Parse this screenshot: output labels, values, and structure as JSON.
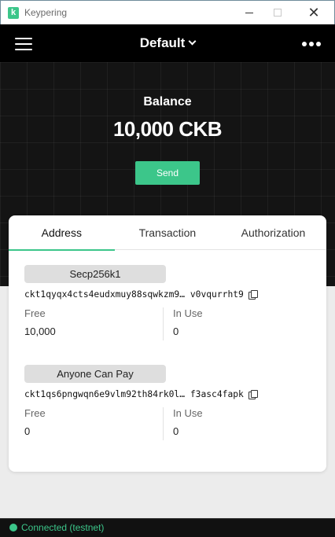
{
  "window": {
    "title": "Keypering",
    "logo_letter": "k"
  },
  "nav": {
    "wallet_name": "Default"
  },
  "hero": {
    "balance_label": "Balance",
    "balance_value": "10,000 CKB",
    "send_label": "Send"
  },
  "tabs": [
    {
      "label": "Address",
      "active": true
    },
    {
      "label": "Transaction",
      "active": false
    },
    {
      "label": "Authorization",
      "active": false
    }
  ],
  "accounts": [
    {
      "lock_type": "Secp256k1",
      "address": "ckt1qyqx4cts4eudxmuy88sqwkzm9… v0vqurrht9",
      "free_label": "Free",
      "free_value": "10,000",
      "in_use_label": "In Use",
      "in_use_value": "0"
    },
    {
      "lock_type": "Anyone Can Pay",
      "address": "ckt1qs6pngwqn6e9vlm92th84rk0l… f3asc4fapk",
      "free_label": "Free",
      "free_value": "0",
      "in_use_label": "In Use",
      "in_use_value": "0"
    }
  ],
  "status": {
    "text": "Connected (testnet)"
  },
  "colors": {
    "accent": "#3cc68a",
    "nav_bg": "#000000",
    "hero_bg": "#141414"
  },
  "icons": [
    "app-logo",
    "hamburger-menu-icon",
    "chevron-down-icon",
    "more-dots-icon",
    "copy-icon",
    "status-dot-icon"
  ]
}
